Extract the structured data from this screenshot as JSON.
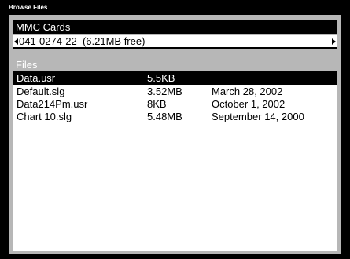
{
  "window": {
    "title": "Browse Files"
  },
  "mmc": {
    "header": "MMC Cards",
    "selected_card": "041-0274-22  (6.21MB free)"
  },
  "files": {
    "header": "Files",
    "rows": [
      {
        "name": "Data.usr",
        "size": "5.5KB",
        "date": "",
        "selected": true
      },
      {
        "name": "Default.slg",
        "size": "3.52MB",
        "date": "March 28, 2002",
        "selected": false
      },
      {
        "name": "Data214Pm.usr",
        "size": "8KB",
        "date": "October 1, 2002",
        "selected": false
      },
      {
        "name": "Chart 10.slg",
        "size": "5.48MB",
        "date": "September 14, 2000",
        "selected": false
      }
    ]
  },
  "colors": {
    "frame": "#000000",
    "panel_gray": "#b7b7b7",
    "selection": "#000000",
    "text": "#000000",
    "header_text": "#ffffff"
  }
}
